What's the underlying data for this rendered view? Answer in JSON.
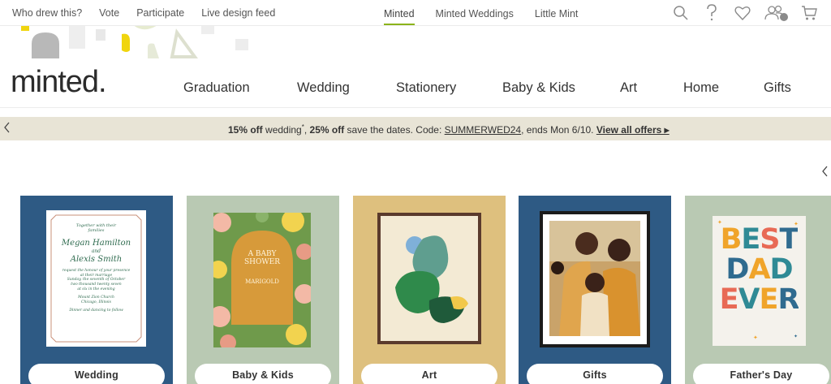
{
  "utility": {
    "links": [
      "Who drew this?",
      "Vote",
      "Participate",
      "Live design feed"
    ],
    "tabs": [
      "Minted",
      "Minted Weddings",
      "Little Mint"
    ],
    "active_tab": "Minted"
  },
  "icons": [
    "search-icon",
    "help-icon",
    "heart-icon",
    "account-icon",
    "cart-icon"
  ],
  "logo": "minted.",
  "nav": [
    "Graduation",
    "Wedding",
    "Stationery",
    "Baby & Kids",
    "Art",
    "Home",
    "Gifts"
  ],
  "promo": {
    "p1": "15% off",
    "p2": " wedding",
    "p3": "*",
    "p4": ", ",
    "p5": "25% off",
    "p6": " save the dates. Code: ",
    "code": "SUMMERWED24",
    "p7": ", ends Mon 6/10. ",
    "offers": "View all offers ▸"
  },
  "cards": [
    {
      "label": "Wedding",
      "bg": "#2e5a84"
    },
    {
      "label": "Baby & Kids",
      "bg": "#b9c9b3"
    },
    {
      "label": "Art",
      "bg": "#dec07e"
    },
    {
      "label": "Gifts",
      "bg": "#2e5a84"
    },
    {
      "label": "Father's Day",
      "bg": "#b9c9b3"
    }
  ],
  "wedding_invite": {
    "l1": "Together with their",
    "l2": "families",
    "n1": "Megan Hamilton",
    "and": "and",
    "n2": "Alexis Smith",
    "d1": "request the honour of your presence",
    "d2": "at their marriage",
    "d3": "Sunday, the seventh of October",
    "d4": "two thousand twenty seven",
    "d5": "at six in the evening",
    "v1": "Mount Zion Church",
    "v2": "Chicago, Illinois",
    "v3": "Dinner and dancing to follow"
  },
  "baby_shower": {
    "l1": "A BABY",
    "l2": "SHOWER",
    "l3": "MARIGOLD"
  },
  "fathers_day": {
    "w1": "BEST",
    "w2": "DAD",
    "w3": "EVER"
  }
}
